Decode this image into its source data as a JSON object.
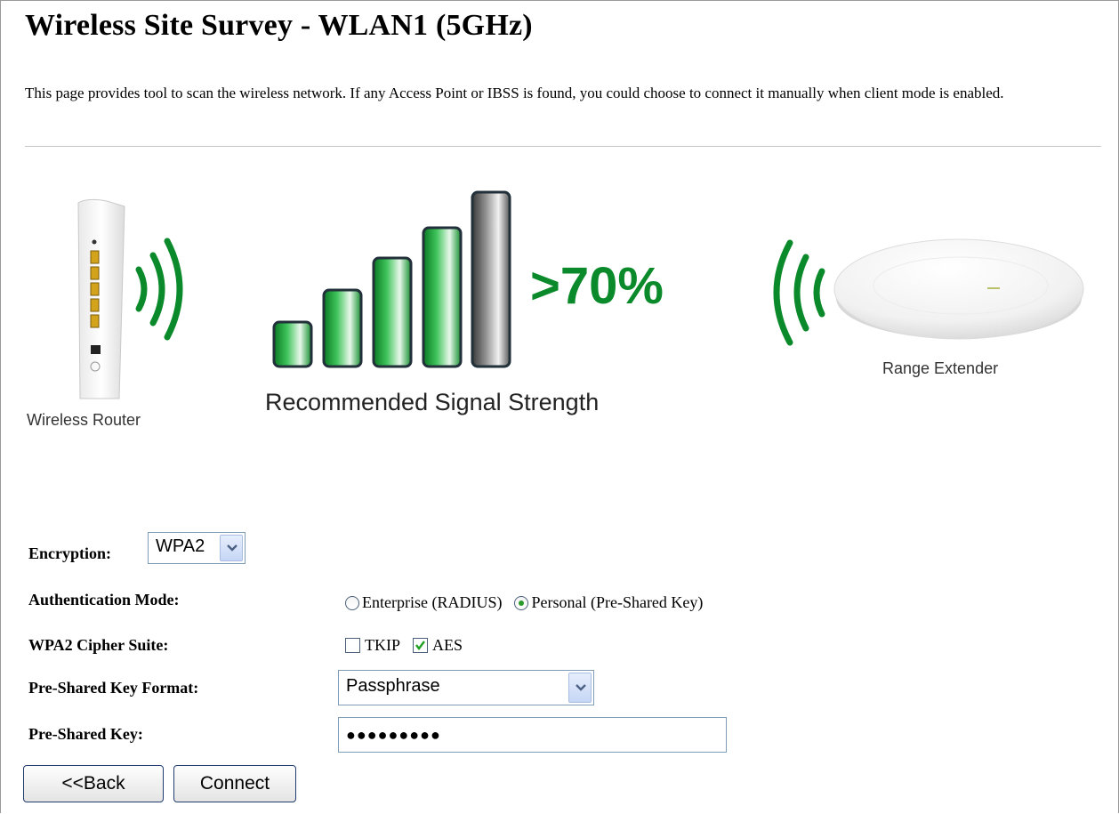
{
  "page": {
    "title": "Wireless Site Survey - WLAN1 (5GHz)",
    "description": "This page provides tool to scan the wireless network. If any Access Point or IBSS is found, you could choose to connect it manually when client mode is enabled."
  },
  "illustration": {
    "router_label": "Wireless Router",
    "signal_percent": ">70%",
    "signal_caption": "Recommended Signal Strength",
    "extender_label": "Range Extender"
  },
  "form": {
    "encryption": {
      "label": "Encryption:",
      "value": "WPA2"
    },
    "auth_mode": {
      "label": "Authentication Mode:",
      "options": [
        {
          "label": "Enterprise (RADIUS)",
          "selected": false
        },
        {
          "label": "Personal (Pre-Shared Key)",
          "selected": true
        }
      ]
    },
    "cipher": {
      "label": "WPA2 Cipher Suite:",
      "options": [
        {
          "label": "TKIP",
          "checked": false
        },
        {
          "label": "AES",
          "checked": true
        }
      ]
    },
    "psk_format": {
      "label": "Pre-Shared Key Format:",
      "value": "Passphrase"
    },
    "psk": {
      "label": "Pre-Shared Key:",
      "value": "●●●●●●●●●"
    }
  },
  "buttons": {
    "back": "<<Back",
    "connect": "Connect"
  },
  "colors": {
    "signal_green": "#0a8a2a",
    "select_border": "#7f9db9"
  }
}
